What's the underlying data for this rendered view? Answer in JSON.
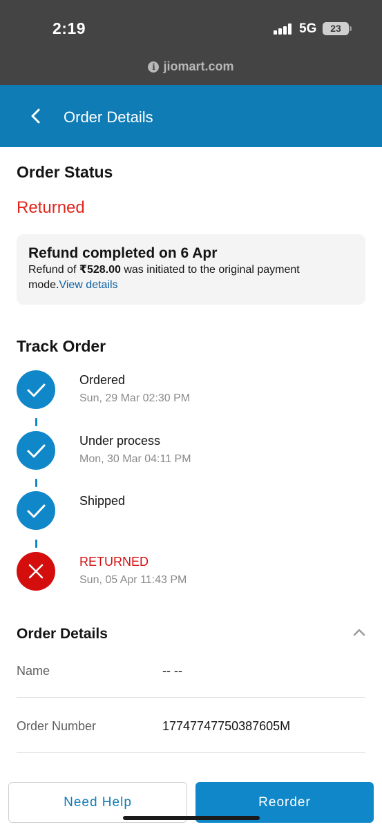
{
  "status_bar": {
    "time": "2:19",
    "network": "5G",
    "battery": "23",
    "url": "jiomart.com"
  },
  "header": {
    "title": "Order Details"
  },
  "order_status": {
    "heading": "Order Status",
    "status": "Returned",
    "status_color": "#e1261c",
    "refund_title": "Refund completed on 6 Apr",
    "refund_prefix": "Refund of ",
    "refund_amount": "₹528.00",
    "refund_suffix": " was initiated to the original payment mode.",
    "refund_link": "View details"
  },
  "track_order": {
    "heading": "Track Order",
    "steps": [
      {
        "label": "Ordered",
        "date": "Sun, 29 Mar 02:30 PM",
        "state": "done"
      },
      {
        "label": "Under process",
        "date": "Mon, 30 Mar 04:11 PM",
        "state": "done"
      },
      {
        "label": "Shipped",
        "date": "",
        "state": "done"
      },
      {
        "label": "RETURNED",
        "date": "Sun, 05 Apr 11:43 PM",
        "state": "failed"
      }
    ]
  },
  "order_details": {
    "heading": "Order Details",
    "rows": [
      {
        "key": "Name",
        "value": "-- --"
      },
      {
        "key": "Order Number",
        "value": "17747747750387605M"
      }
    ]
  },
  "actions": {
    "help_label": "Need Help",
    "reorder_label": "Reorder"
  },
  "colors": {
    "brand_blue": "#0f7cb6",
    "success_blue": "#0f87c9",
    "error_red": "#d40d0d"
  }
}
